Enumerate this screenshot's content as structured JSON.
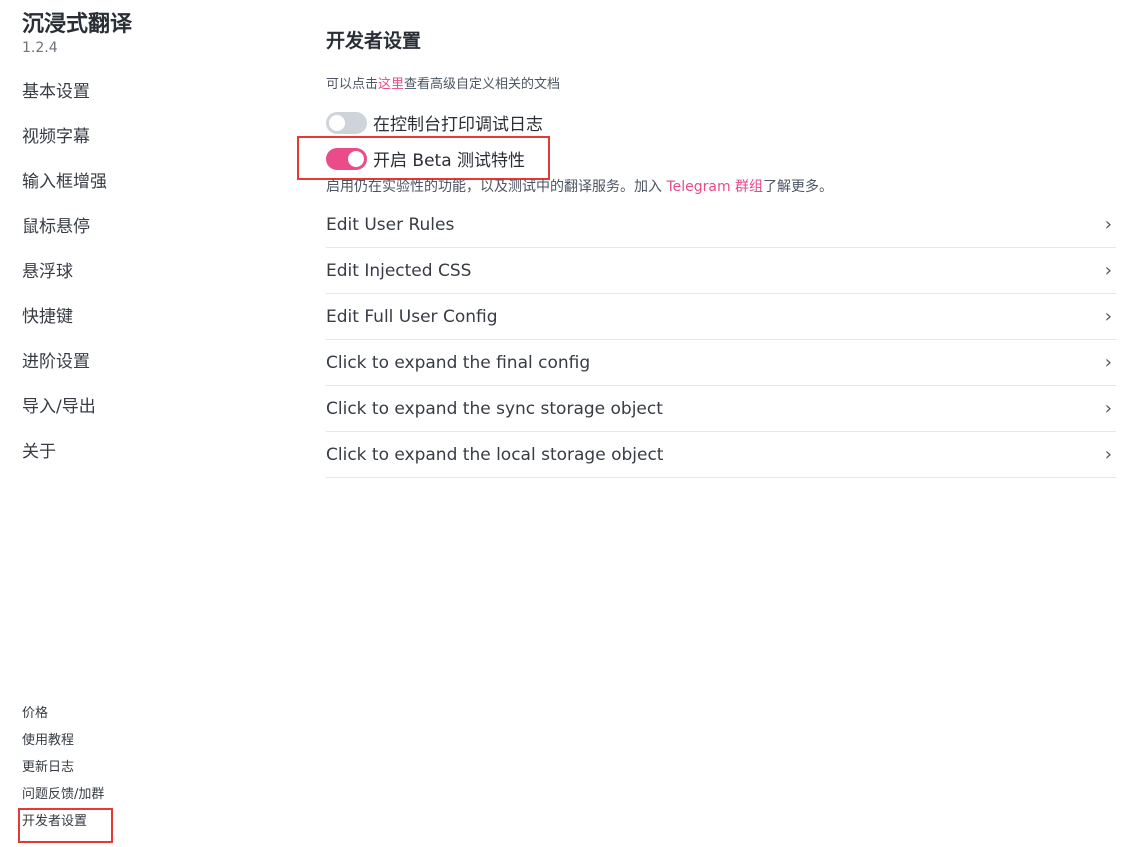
{
  "app": {
    "title": "沉浸式翻译",
    "version": "1.2.4"
  },
  "sidebar": {
    "items": [
      {
        "label": "基本设置"
      },
      {
        "label": "视频字幕"
      },
      {
        "label": "输入框增强"
      },
      {
        "label": "鼠标悬停"
      },
      {
        "label": "悬浮球"
      },
      {
        "label": "快捷键"
      },
      {
        "label": "进阶设置"
      },
      {
        "label": "导入/导出"
      },
      {
        "label": "关于"
      }
    ],
    "footer_links": [
      {
        "label": "价格"
      },
      {
        "label": "使用教程"
      },
      {
        "label": "更新日志"
      },
      {
        "label": "问题反馈/加群"
      },
      {
        "label": "开发者设置",
        "active": true
      }
    ]
  },
  "main": {
    "title": "开发者设置",
    "docs_note": {
      "prefix": "可以点击",
      "link": "这里",
      "suffix": "查看高级自定义相关的文档"
    },
    "toggles": [
      {
        "label": "在控制台打印调试日志",
        "state": "off"
      },
      {
        "label": "开启 Beta 测试特性",
        "state": "on"
      }
    ],
    "beta_desc": {
      "prefix": "启用仍在实验性的功能，以及测试中的翻译服务。加入 ",
      "link": "Telegram 群组",
      "suffix": "了解更多。"
    },
    "rows": [
      {
        "label": "Edit User Rules"
      },
      {
        "label": "Edit Injected CSS"
      },
      {
        "label": "Edit Full User Config"
      },
      {
        "label": "Click to expand the final config"
      },
      {
        "label": "Click to expand the sync storage object"
      },
      {
        "label": "Click to expand the local storage object"
      }
    ],
    "chevron": "›"
  },
  "colors": {
    "accent": "#ea4c89",
    "link": "#e64a8b",
    "highlight": "#e53935",
    "toggle_off": "#ced4da"
  }
}
